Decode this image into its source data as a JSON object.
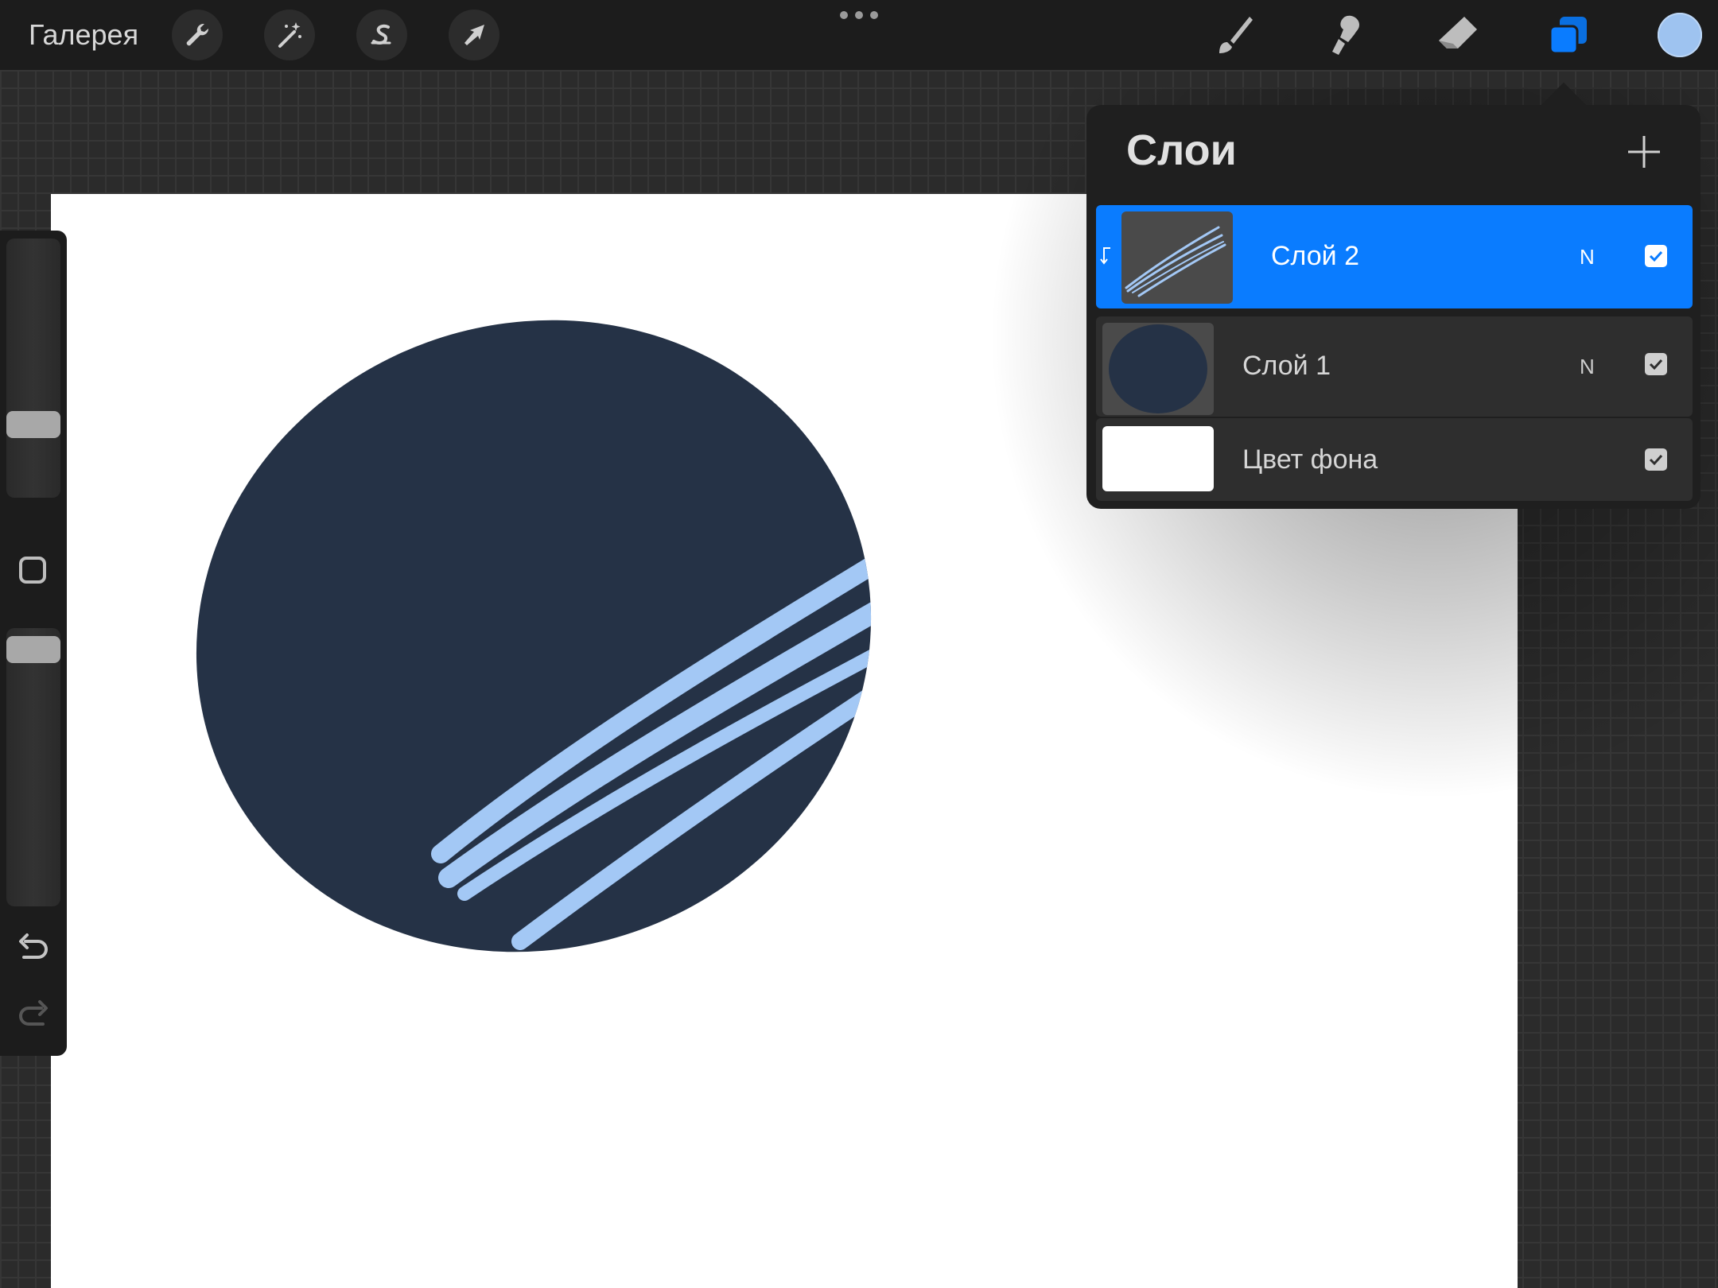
{
  "toolbar": {
    "gallery_label": "Галерея",
    "left_tools": [
      "wrench-icon",
      "magic-wand-icon",
      "selection-icon",
      "transform-arrow-icon"
    ],
    "right_tools": [
      "brush-icon",
      "smudge-icon",
      "eraser-icon",
      "layers-icon"
    ],
    "active_color": "#9ec3f0",
    "active_tool_color": "#0a7cff"
  },
  "sidebar": {
    "brush_size_level": 0.37,
    "opacity_level": 0.04
  },
  "layers_panel": {
    "title": "Слои",
    "layers": [
      {
        "name": "Слой 2",
        "blend_mode": "N",
        "visible": true,
        "selected": true,
        "clipping": true
      },
      {
        "name": "Слой 1",
        "blend_mode": "N",
        "visible": true,
        "selected": false
      },
      {
        "name": "Цвет фона",
        "blend_mode": "",
        "visible": true,
        "selected": false
      }
    ]
  },
  "canvas": {
    "background": "#ffffff",
    "circle_color": "#253246",
    "stroke_color": "#a3c8f5"
  }
}
